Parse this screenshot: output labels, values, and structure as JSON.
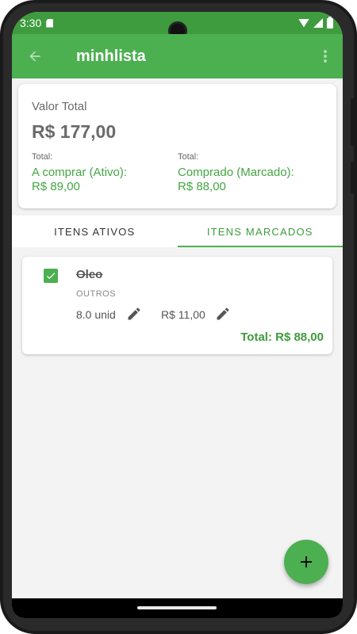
{
  "status_bar": {
    "time": "3:30"
  },
  "app_bar": {
    "title": "minhlista",
    "back_icon": "arrow-back-icon",
    "menu_icon": "more-vert-icon",
    "color": "#4caf50"
  },
  "summary": {
    "label": "Valor Total",
    "value": "R$ 177,00",
    "active": {
      "title": "Total:",
      "label": "A comprar (Ativo):",
      "value": "R$ 89,00"
    },
    "marked": {
      "title": "Total:",
      "label": "Comprado (Marcado):",
      "value": "R$ 88,00"
    }
  },
  "tabs": [
    {
      "label": "ITENS ATIVOS",
      "active": false
    },
    {
      "label": "ITENS MARCADOS",
      "active": true
    }
  ],
  "items": [
    {
      "checked": true,
      "name": "Oleo",
      "category": "OUTROS",
      "quantity": "8.0 unid",
      "price": "R$ 11,00",
      "total": "Total: R$ 88,00"
    }
  ],
  "fab": {
    "icon": "plus-icon"
  },
  "colors": {
    "primary": "#4caf50",
    "status_bar": "#3e9b3e",
    "accent_text": "#44a544"
  }
}
